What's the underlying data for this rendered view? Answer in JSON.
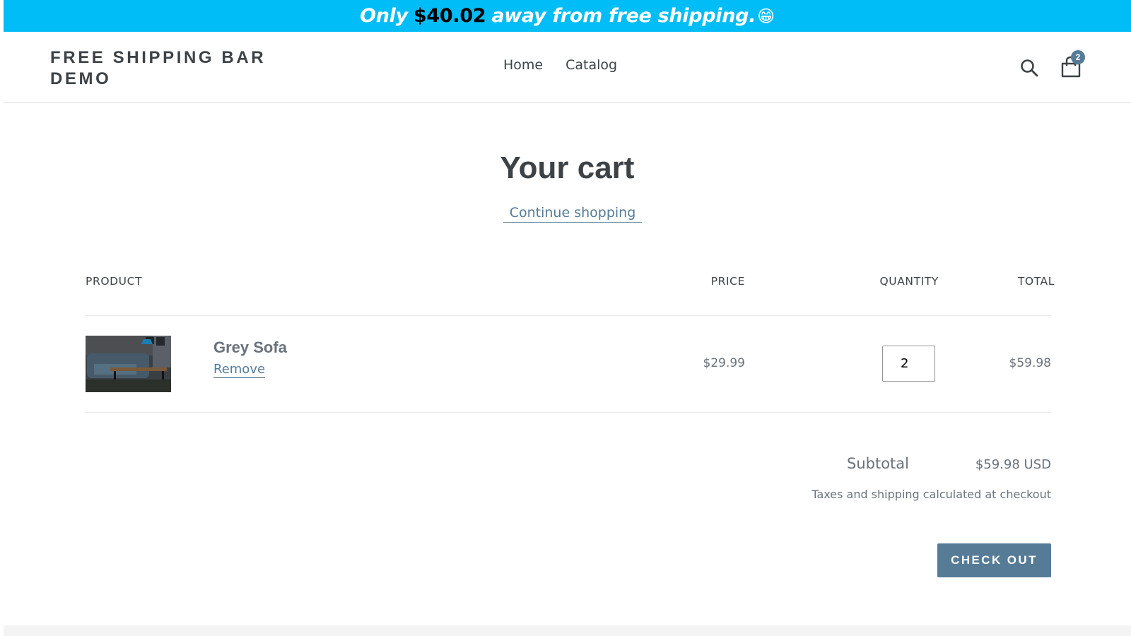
{
  "announcement": {
    "prefix": "Only",
    "amount": "$40.02",
    "suffix": "away from free shipping.",
    "emoji": "😁",
    "background_color": "#00bdf7"
  },
  "header": {
    "logo": "FREE SHIPPING BAR DEMO",
    "nav": [
      {
        "label": "Home"
      },
      {
        "label": "Catalog"
      }
    ],
    "search_icon": "search-icon",
    "cart_icon": "shopping-bag-icon",
    "cart_count": "2"
  },
  "cart": {
    "title": "Your cart",
    "continue_label": "Continue shopping",
    "columns": {
      "product": "PRODUCT",
      "price": "PRICE",
      "quantity": "QUANTITY",
      "total": "TOTAL"
    },
    "items": [
      {
        "name": "Grey Sofa",
        "remove_label": "Remove",
        "price": "$29.99",
        "quantity": "2",
        "total": "$59.98"
      }
    ],
    "subtotal_label": "Subtotal",
    "subtotal_value": "$59.98 USD",
    "tax_note": "Taxes and shipping calculated at checkout",
    "checkout_label": "CHECK OUT",
    "accent_color": "#557b97"
  }
}
